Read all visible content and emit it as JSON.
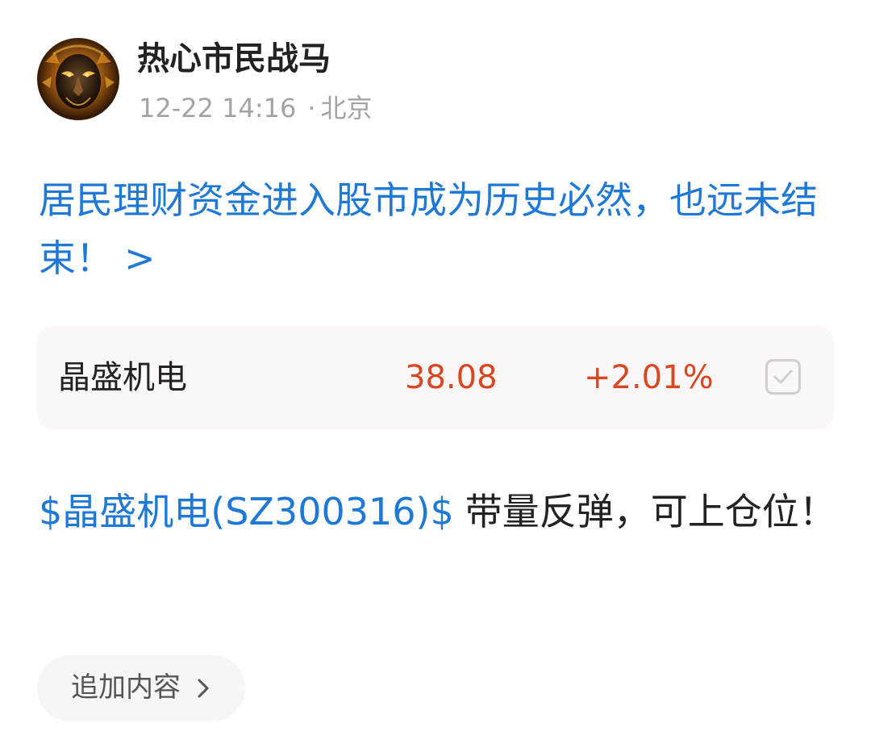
{
  "post": {
    "author": {
      "name": "热心市民战马",
      "avatar_icon": "lion-avatar-icon"
    },
    "time": "12-22 14:16",
    "location_separator": "·",
    "location": "北京",
    "title_link": {
      "text": "居民理财资金进入股市成为历史必然，也远未结束！",
      "chevron": ">"
    },
    "stock_card": {
      "name": "晶盛机电",
      "price": "38.08",
      "change": "+2.01%",
      "price_color": "#d9461f",
      "action_icon": "checkbox-checked-icon"
    },
    "body": {
      "stock_tag": "$晶盛机电(SZ300316)$",
      "text": "带量反弹，可上仓位！"
    },
    "append_button": {
      "label": "追加内容",
      "icon": "chevron-right-icon"
    }
  },
  "colors": {
    "link": "#1e78d6",
    "text": "#222222",
    "meta": "#a3a3a3",
    "up": "#d9461f"
  }
}
